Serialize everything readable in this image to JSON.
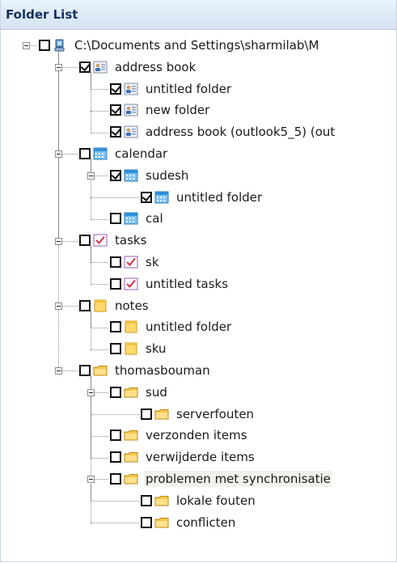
{
  "header": {
    "title": "Folder List"
  },
  "tree": [
    {
      "label": "C:\\Documents and Settings\\sharmilab\\M",
      "icon": "computer-icon",
      "checked": false,
      "expander": "minus",
      "indent": 0
    },
    {
      "label": "address book",
      "icon": "contacts-folder-icon",
      "checked": true,
      "expander": "minus",
      "indent": 1
    },
    {
      "label": "untitled folder",
      "icon": "contacts-folder-icon",
      "checked": true,
      "expander": "",
      "indent": 2
    },
    {
      "label": "new folder",
      "icon": "contacts-folder-icon",
      "checked": true,
      "expander": "",
      "indent": 2
    },
    {
      "label": "address book (outlook5_5) (out",
      "icon": "contacts-folder-icon",
      "checked": true,
      "expander": "",
      "indent": 2
    },
    {
      "label": "calendar",
      "icon": "calendar-folder-icon",
      "checked": false,
      "expander": "minus",
      "indent": 1
    },
    {
      "label": "sudesh",
      "icon": "calendar-folder-icon",
      "checked": true,
      "expander": "minus",
      "indent": 2
    },
    {
      "label": "untitled folder",
      "icon": "calendar-folder-icon",
      "checked": true,
      "expander": "",
      "indent": 3
    },
    {
      "label": "cal",
      "icon": "calendar-folder-icon",
      "checked": false,
      "expander": "",
      "indent": 2
    },
    {
      "label": "tasks",
      "icon": "tasks-folder-icon",
      "checked": false,
      "expander": "minus",
      "indent": 1
    },
    {
      "label": "sk",
      "icon": "tasks-folder-icon",
      "checked": false,
      "expander": "",
      "indent": 2
    },
    {
      "label": "untitled tasks",
      "icon": "tasks-folder-icon",
      "checked": false,
      "expander": "",
      "indent": 2
    },
    {
      "label": "notes",
      "icon": "notes-folder-icon",
      "checked": false,
      "expander": "minus",
      "indent": 1
    },
    {
      "label": "untitled folder",
      "icon": "notes-folder-icon",
      "checked": false,
      "expander": "",
      "indent": 2
    },
    {
      "label": "sku",
      "icon": "notes-folder-icon",
      "checked": false,
      "expander": "",
      "indent": 2
    },
    {
      "label": "thomasbouman",
      "icon": "mail-folder-icon",
      "checked": false,
      "expander": "minus",
      "indent": 1
    },
    {
      "label": "sud",
      "icon": "mail-folder-icon",
      "checked": false,
      "expander": "minus",
      "indent": 2
    },
    {
      "label": "serverfouten",
      "icon": "mail-folder-icon",
      "checked": false,
      "expander": "",
      "indent": 3
    },
    {
      "label": "verzonden items",
      "icon": "mail-folder-icon",
      "checked": false,
      "expander": "",
      "indent": 2
    },
    {
      "label": "verwijderde items",
      "icon": "mail-folder-icon",
      "checked": false,
      "expander": "",
      "indent": 2
    },
    {
      "label": "problemen met synchronisatie",
      "icon": "mail-folder-icon",
      "checked": false,
      "expander": "minus",
      "indent": 2,
      "highlight": true
    },
    {
      "label": "lokale fouten",
      "icon": "mail-folder-icon",
      "checked": false,
      "expander": "",
      "indent": 3
    },
    {
      "label": "conflicten",
      "icon": "mail-folder-icon",
      "checked": false,
      "expander": "",
      "indent": 3
    }
  ]
}
